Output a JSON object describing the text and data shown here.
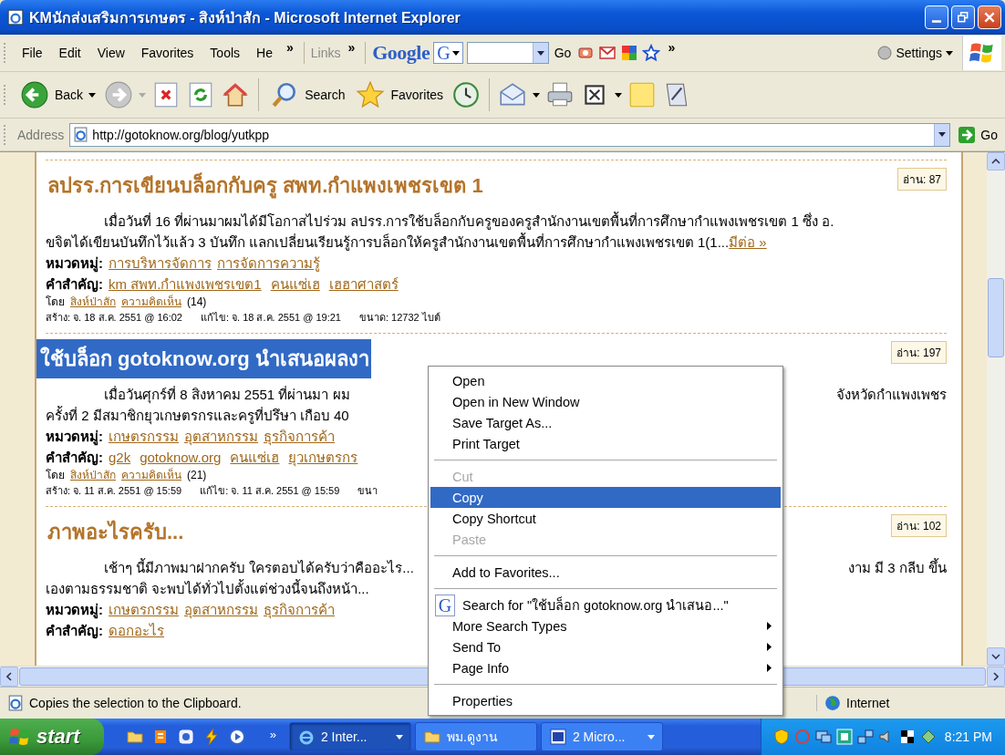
{
  "window": {
    "title": "KMนักส่งเสริมการเกษตร - สิงห์ป่าสัก - Microsoft Internet Explorer"
  },
  "menu_bar": {
    "items": [
      "File",
      "Edit",
      "View",
      "Favorites",
      "Tools",
      "He"
    ],
    "overflow": "»",
    "links_label": "Links",
    "links_overflow": "»",
    "google_logo": "Google",
    "google_menu_letter": "G",
    "go": "Go",
    "google_overflow": "»",
    "settings": "Settings"
  },
  "toolbar": {
    "back": "Back",
    "search": "Search",
    "favorites": "Favorites"
  },
  "address_bar": {
    "label": "Address",
    "value": "http://gotoknow.org/blog/yutkpp",
    "go": "Go"
  },
  "posts": [
    {
      "title": "ลปรร.การเขียนบล็อกกับครู สพท.กำแพงเพชรเขต 1",
      "selected": false,
      "reads": "อ่าน: 87",
      "lines": [
        {
          "left": "เมื่อวันที่ 16 ที่ผ่านมาผมได้มีโอกาสไปร่วม ลปรร.การใช้บล็อกกับครูของครูสำนักงานเขตพื้นที่การศึกษากำแพงเพชรเขต 1 ซึ่ง อ.",
          "indent": true
        },
        {
          "left": "ขจิตได้เขียนบันทึกไว้แล้ว 3 บันทึก แลกเปลี่ยนเรียนรู้การบล็อกให้ครูสำนักงานเขตพื้นที่การศึกษากำแพงเพชรเขต 1(1...",
          "more": "มีต่อ »",
          "indent": false
        }
      ],
      "category_label": "หมวดหมู่:",
      "categories": [
        "การบริหารจัดการ",
        "การจัดการความรู้"
      ],
      "keyword_label": "คำสำคัญ:",
      "keywords": [
        "km สพท.กำแพงเพชรเขต1",
        "คนแซ่เฮ",
        "เฮฮาศาสตร์"
      ],
      "by_label": "โดย",
      "author": "สิงห์ป่าสัก",
      "comments_link": "ความคิดเห็น",
      "comments_count": "(14)",
      "meta": [
        "สร้าง: จ. 18 ส.ค. 2551 @ 16:02",
        "แก้ไข: จ. 18 ส.ค. 2551 @ 19:21",
        "ขนาด: 12732 ไบต์"
      ]
    },
    {
      "title": "ใช้บล็อก gotoknow.org นำเสนอผลงา",
      "selected": true,
      "reads": "อ่าน: 197",
      "lines": [
        {
          "left": "เมื่อวันศุกร์ที่ 8 สิงหาคม 2551 ที่ผ่านมา ผม",
          "right": "จังหวัดกำแพงเพชร",
          "indent": true
        },
        {
          "left": "ครั้งที่ 2  มีสมาชิกยุวเกษตรกรและครูที่ปรึษา เกือบ 40",
          "indent": false
        }
      ],
      "category_label": "หมวดหมู่:",
      "categories": [
        "เกษตรกรรม",
        "อุตสาหกรรม",
        "ธุรกิจการค้า"
      ],
      "keyword_label": "คำสำคัญ:",
      "keywords": [
        "g2k",
        "gotoknow.org",
        "คนแซ่เฮ",
        "ยุวเกษตรกร"
      ],
      "by_label": "โดย",
      "author": "สิงห์ป่าสัก",
      "comments_link": "ความคิดเห็น",
      "comments_count": "(21)",
      "meta": [
        "สร้าง: จ. 11 ส.ค. 2551 @ 15:59",
        "แก้ไข: จ. 11 ส.ค. 2551 @ 15:59",
        "ขนา"
      ]
    },
    {
      "title": "ภาพอะไรครับ...",
      "selected": false,
      "reads": "อ่าน: 102",
      "lines": [
        {
          "left": "เช้าๆ นี้มีภาพมาฝากครับ  ใครตอบได้ครับว่าคืออะไร...",
          "right": "งาม  มี 3 กลีบ        ขึ้น",
          "indent": true
        },
        {
          "left": "เองตามธรรมชาติ  จะพบได้ทั่วไปตั้งแต่ช่วงนี้จนถึงหน้า...",
          "indent": false
        }
      ],
      "category_label": "หมวดหมู่:",
      "categories": [
        "เกษตรกรรม",
        "อุตสาหกรรม",
        "ธุรกิจการค้า"
      ],
      "keyword_label": "คำสำคัญ:",
      "keywords": [
        "ดอกอะไร"
      ]
    }
  ],
  "context_menu": {
    "items": [
      {
        "kind": "item",
        "label": "Open",
        "disabled": false,
        "selected": false,
        "submenu": false
      },
      {
        "kind": "item",
        "label": "Open in New Window",
        "disabled": false,
        "selected": false,
        "submenu": false
      },
      {
        "kind": "item",
        "label": "Save Target As...",
        "disabled": false,
        "selected": false,
        "submenu": false
      },
      {
        "kind": "item",
        "label": "Print Target",
        "disabled": false,
        "selected": false,
        "submenu": false
      },
      {
        "kind": "separator"
      },
      {
        "kind": "item",
        "label": "Cut",
        "disabled": true,
        "selected": false,
        "submenu": false
      },
      {
        "kind": "item",
        "label": "Copy",
        "disabled": false,
        "selected": true,
        "submenu": false
      },
      {
        "kind": "item",
        "label": "Copy Shortcut",
        "disabled": false,
        "selected": false,
        "submenu": false
      },
      {
        "kind": "item",
        "label": "Paste",
        "disabled": true,
        "selected": false,
        "submenu": false
      },
      {
        "kind": "separator"
      },
      {
        "kind": "item",
        "label": "Add to Favorites...",
        "disabled": false,
        "selected": false,
        "submenu": false
      },
      {
        "kind": "separator"
      },
      {
        "kind": "google",
        "icon_letter": "G",
        "label": "Search for \"ใช้บล็อก gotoknow.org นำเสนอ...\"",
        "disabled": false,
        "selected": false,
        "submenu": false
      },
      {
        "kind": "item",
        "label": "More Search Types",
        "disabled": false,
        "selected": false,
        "submenu": true
      },
      {
        "kind": "item",
        "label": "Send To",
        "disabled": false,
        "selected": false,
        "submenu": true
      },
      {
        "kind": "item",
        "label": "Page Info",
        "disabled": false,
        "selected": false,
        "submenu": true
      },
      {
        "kind": "separator"
      },
      {
        "kind": "item",
        "label": "Properties",
        "disabled": false,
        "selected": false,
        "submenu": false
      }
    ]
  },
  "status_bar": {
    "text": "Copies the selection to the Clipboard.",
    "zone": "Internet"
  },
  "taskbar": {
    "start": "start",
    "overflow": "»",
    "tasks": [
      {
        "kind": "ie",
        "label": "2 Inter...",
        "group": true,
        "selected": true
      },
      {
        "kind": "folder",
        "label": "พม.ดูงาน",
        "group": false,
        "selected": false
      },
      {
        "kind": "word",
        "label": "2 Micro...",
        "group": true,
        "selected": false
      }
    ],
    "clock": "8:21 PM"
  }
}
